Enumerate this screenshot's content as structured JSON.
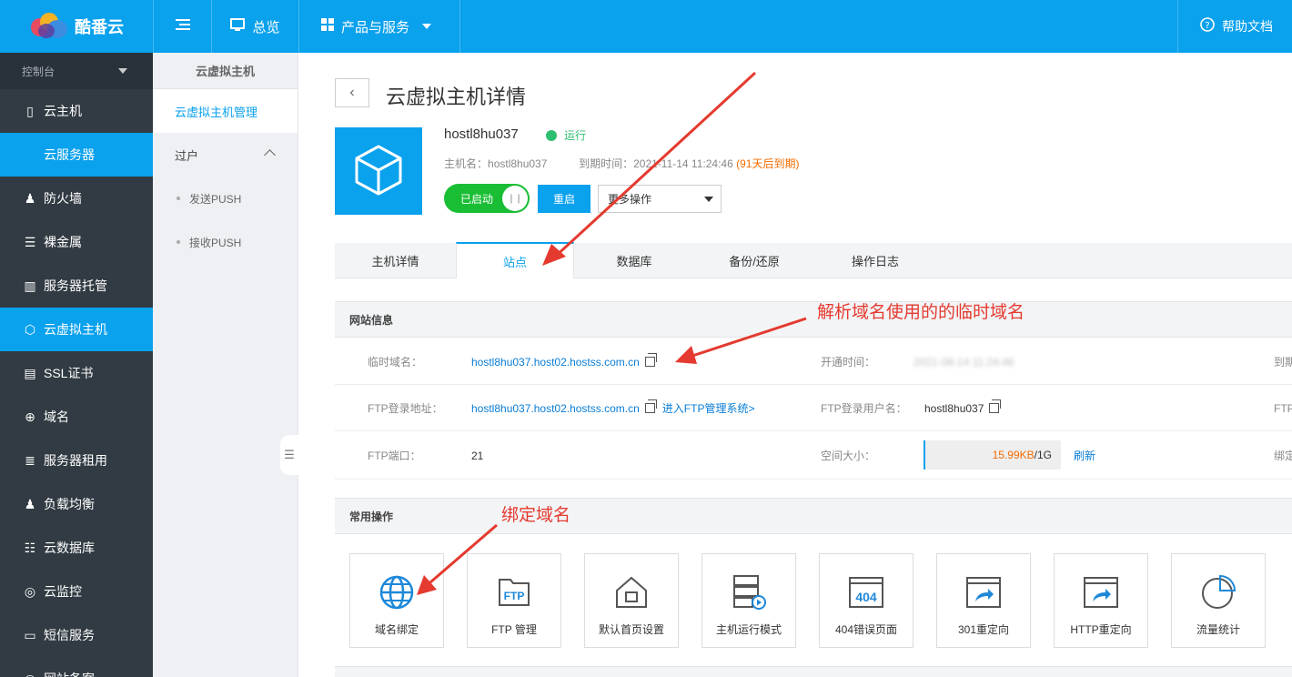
{
  "brand": {
    "name": "酷番云"
  },
  "topnav": {
    "menu_icon": "menu-icon",
    "overview": "总览",
    "products": "产品与服务",
    "help": "帮助文档"
  },
  "sidebar": {
    "header": "控制台",
    "items": [
      {
        "label": "云主机",
        "icon": "server-icon"
      },
      {
        "label": "云服务器",
        "icon": ""
      },
      {
        "label": "防火墙",
        "icon": "firewall-icon"
      },
      {
        "label": "裸金属",
        "icon": "baremetal-icon"
      },
      {
        "label": "服务器托管",
        "icon": "hosting-icon"
      },
      {
        "label": "云虚拟主机",
        "icon": "cube-icon"
      },
      {
        "label": "SSL证书",
        "icon": "certificate-icon"
      },
      {
        "label": "域名",
        "icon": "globe-icon"
      },
      {
        "label": "服务器租用",
        "icon": "rental-icon"
      },
      {
        "label": "负载均衡",
        "icon": "loadbalance-icon"
      },
      {
        "label": "云数据库",
        "icon": "database-icon"
      },
      {
        "label": "云监控",
        "icon": "monitor-icon"
      },
      {
        "label": "短信服务",
        "icon": "sms-icon"
      },
      {
        "label": "网站备案",
        "icon": "record-icon"
      }
    ]
  },
  "subsidebar": {
    "title": "云虚拟主机",
    "active": "云虚拟主机管理",
    "group": "过户",
    "leaves": [
      "发送PUSH",
      "接收PUSH"
    ]
  },
  "page": {
    "title": "云虚拟主机详情",
    "host_name": "hostl8hu037",
    "status": "运行",
    "meta_host_label": "主机名：",
    "meta_host_value": "hostl8hu037",
    "meta_expire_label": "到期时间：",
    "meta_expire_value": "2021-11-14 11:24:46",
    "meta_expire_warn": "(91天后到期)",
    "toggle_label": "已启动",
    "restart": "重启",
    "more_ops": "更多操作"
  },
  "tabs": [
    "主机详情",
    "站点",
    "数据库",
    "备份/还原",
    "操作日志"
  ],
  "site_info": {
    "title": "网站信息",
    "temp_domain_label": "临时域名：",
    "temp_domain": "hostl8hu037.host02.hostss.com.cn",
    "open_time_label": "开通时间：",
    "open_time": "2021-08-14 11:24:46",
    "expire_label_cut": "到期",
    "ftp_addr_label": "FTP登录地址：",
    "ftp_addr": "hostl8hu037.host02.hostss.com.cn",
    "ftp_enter": "进入FTP管理系统>",
    "ftp_user_label": "FTP登录用户名：",
    "ftp_user": "hostl8hu037",
    "ftp_cut": "FTP",
    "ftp_port_label": "FTP端口：",
    "ftp_port": "21",
    "space_label": "空间大小：",
    "space_used": "15.99KB",
    "space_total": "/1G",
    "refresh": "刷新",
    "bind_cut": "绑定"
  },
  "common_ops": {
    "title": "常用操作",
    "items": [
      {
        "label": "域名绑定",
        "icon": "globe-icon"
      },
      {
        "label": "FTP 管理",
        "icon": "ftp-folder-icon"
      },
      {
        "label": "默认首页设置",
        "icon": "home-page-icon"
      },
      {
        "label": "主机运行模式",
        "icon": "server-play-icon"
      },
      {
        "label": "404错误页面",
        "icon": "error-404-icon"
      },
      {
        "label": "301重定向",
        "icon": "redirect-301-icon"
      },
      {
        "label": "HTTP重定向",
        "icon": "redirect-http-icon"
      },
      {
        "label": "流量统计",
        "icon": "pie-chart-icon"
      }
    ]
  },
  "annotations": {
    "temp_domain_note": "解析域名使用的的临时域名",
    "bind_note": "绑定域名"
  },
  "colors": {
    "accent": "#0aa1ed",
    "sidebar": "#323b43",
    "running": "#2fbf71",
    "annotation": "#e43a2f",
    "warning": "#f56b00"
  }
}
